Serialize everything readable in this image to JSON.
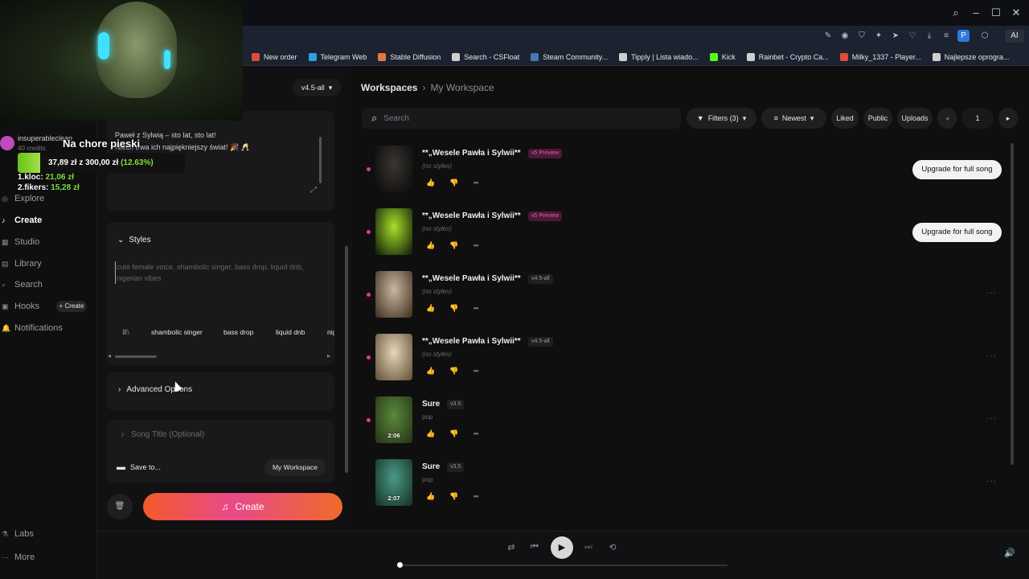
{
  "bookmarks": [
    {
      "label": "New order",
      "color": "#e04a3a"
    },
    {
      "label": "Telegram Web",
      "color": "#2aa2e0"
    },
    {
      "label": "Stable Diffusion",
      "color": "#e07a3a"
    },
    {
      "label": "Search - CSFloat",
      "color": "#cfcfcf"
    },
    {
      "label": "Steam Community...",
      "color": "#4a78b0"
    },
    {
      "label": "Tipply | Lista wiado...",
      "color": "#cfcfcf"
    },
    {
      "label": "Kick",
      "color": "#53fc18"
    },
    {
      "label": "Rainbet - Crypto Ca...",
      "color": "#cfcfcf"
    },
    {
      "label": "Milky_1337 - Player...",
      "color": "#e04a3a"
    },
    {
      "label": "Najlepsze oprogra...",
      "color": "#cfcfcf"
    }
  ],
  "browser": {
    "profile_letter": "P",
    "ai_label": "AI"
  },
  "overlay": {
    "account_name": "insuperableclean",
    "credits": "40 credits",
    "donation_title": "Na chore pieski",
    "donation_amount": "37,89 zł",
    "donation_of": "z",
    "donation_goal": "300,00 zł",
    "donation_pct": "(12.63%)",
    "donation_fraction": 0.1263,
    "leader1_name": "1.kloc:",
    "leader1_amount": "21,06 zł",
    "leader2_name": "2.fikers:",
    "leader2_amount": "15,28 zł"
  },
  "sidebar": {
    "items": [
      {
        "label": "Explore",
        "icon": "compass-icon"
      },
      {
        "label": "Create",
        "icon": "music-icon"
      },
      {
        "label": "Studio",
        "icon": "studio-icon"
      },
      {
        "label": "Library",
        "icon": "library-icon"
      },
      {
        "label": "Search",
        "icon": "search-icon"
      },
      {
        "label": "Hooks",
        "icon": "hooks-icon"
      },
      {
        "label": "Notifications",
        "icon": "bell-icon"
      }
    ],
    "hooks_create": "+ Create",
    "bottom": [
      "Labs",
      "More"
    ]
  },
  "create_panel": {
    "version": "v4.5-all",
    "lyrics_line1": "Paweł z Sylwią – sto lat, sto lat!",
    "lyrics_line2": "Niech trwa ich najpiękniejszy świat! 🎉 🥂",
    "styles_heading": "Styles",
    "styles_placeholder": "cute female voice, shambolic singer, bass drop, liquid dnb, nigerian vibes",
    "style_tags": [
      "shambolic singer",
      "bass drop",
      "liquid dnb",
      "nig"
    ],
    "advanced_label": "Advanced Options",
    "song_title_placeholder": "Song Title (Optional)",
    "save_to_label": "Save to...",
    "workspace_name": "My Workspace",
    "create_label": "Create"
  },
  "workspace": {
    "breadcrumb_root": "Workspaces",
    "breadcrumb_current": "My Workspace",
    "search_placeholder": "Search",
    "filters_label": "Filters (3)",
    "sort_label": "Newest",
    "liked_label": "Liked",
    "public_label": "Public",
    "uploads_label": "Uploads",
    "page_number": "1",
    "upgrade_label": "Upgrade for full song",
    "songs": [
      {
        "title": "**„Wesele Pawła i Sylwii**",
        "badge": "v5 Preview",
        "badge_type": "preview",
        "sub": "(no styles)",
        "duration": "",
        "upgrade": true,
        "thumb_a": "#3a3630",
        "thumb_b": "#0e0e0e"
      },
      {
        "title": "**„Wesele Pawła i Sylwii**",
        "badge": "v5 Preview",
        "badge_type": "preview",
        "sub": "(no styles)",
        "duration": "",
        "upgrade": true,
        "thumb_a": "#a8e02a",
        "thumb_b": "#1a2a0a"
      },
      {
        "title": "**„Wesele Pawła i Sylwii**",
        "badge": "v4.5-all",
        "badge_type": "ver",
        "sub": "(no styles)",
        "duration": "",
        "upgrade": false,
        "thumb_a": "#c8b8a0",
        "thumb_b": "#4a3a2a"
      },
      {
        "title": "**„Wesele Pawła i Sylwii**",
        "badge": "v4.5-all",
        "badge_type": "ver",
        "sub": "(no styles)",
        "duration": "",
        "upgrade": false,
        "thumb_a": "#e8d8b8",
        "thumb_b": "#6a5a40"
      },
      {
        "title": "Sure",
        "badge": "v3.5",
        "badge_type": "ver",
        "sub": "pop",
        "duration": "2:06",
        "upgrade": false,
        "thumb_a": "#5a8a3a",
        "thumb_b": "#2a3a1a"
      },
      {
        "title": "Sure",
        "badge": "v3.5",
        "badge_type": "ver",
        "sub": "pop",
        "duration": "2:07",
        "upgrade": false,
        "thumb_a": "#4a9a8a",
        "thumb_b": "#1a3a2a"
      }
    ]
  },
  "player": {
    "progress": 0.0
  }
}
